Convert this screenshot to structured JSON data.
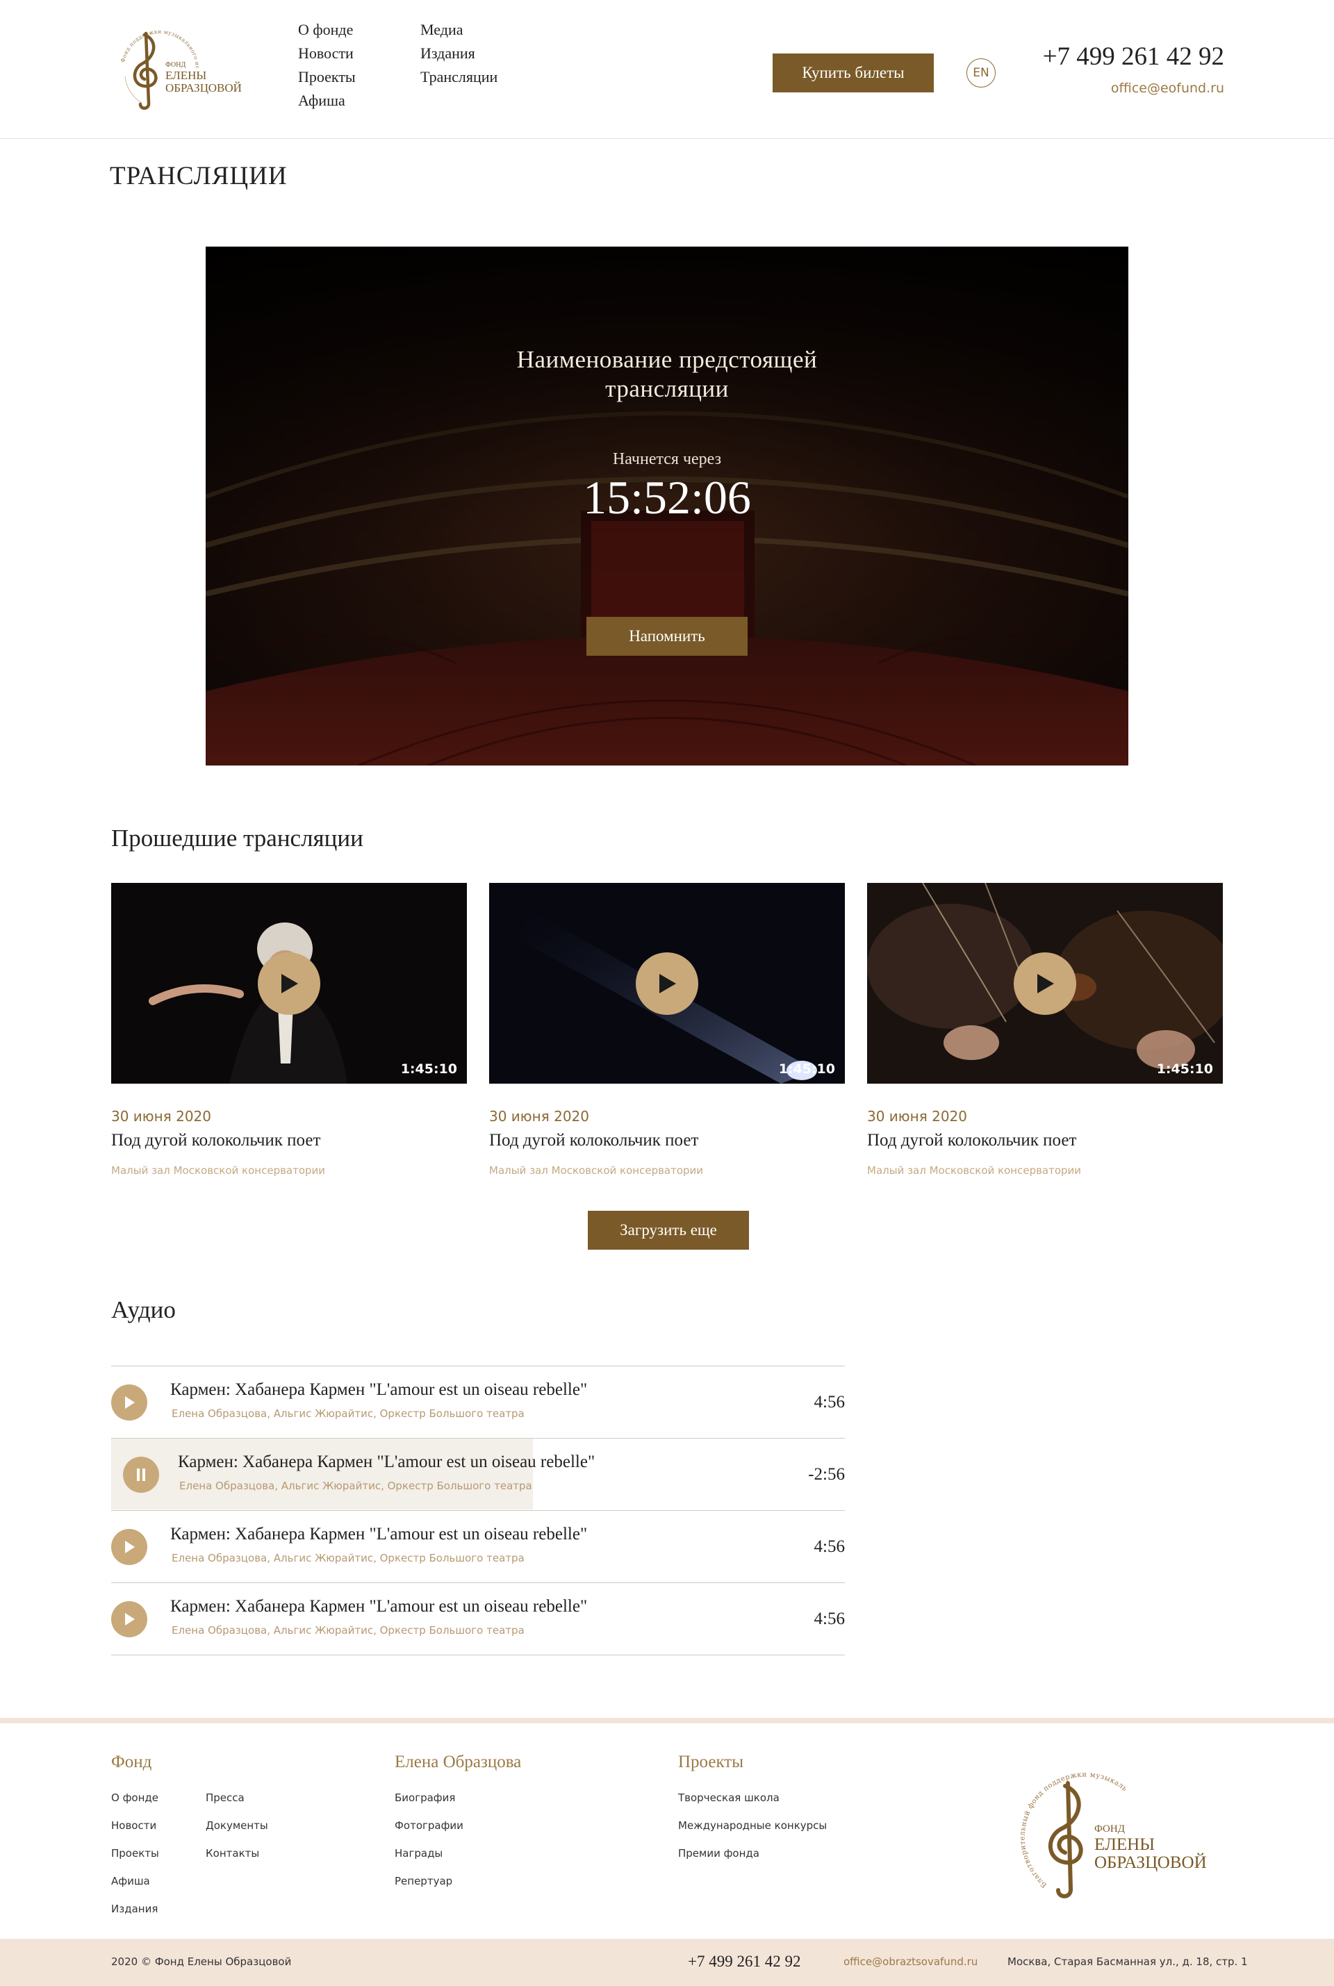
{
  "logo": {
    "arc_text": "Фонд поддержки музыкального искусства",
    "line1": "ФОНД",
    "line2": "ЕЛЕНЫ",
    "line3": "ОБРАЗЦОВОЙ"
  },
  "nav": {
    "col1": [
      "О фонде",
      "Новости",
      "Проекты",
      "Афиша"
    ],
    "col2": [
      "Медиа",
      "Издания",
      "Трансляции"
    ]
  },
  "header": {
    "buy_tickets": "Купить билеты",
    "lang": "EN",
    "phone": "+7 499 261 42 92",
    "email": "office@eofund.ru"
  },
  "page_title": "ТРАНСЛЯЦИИ",
  "hero": {
    "title_line1": "Наименование предстоящей",
    "title_line2": "трансляции",
    "timer_label": "Начнется через",
    "timer": "15:52:06",
    "remind": "Напомнить"
  },
  "past": {
    "heading": "Прошедшие трансляции",
    "cards": [
      {
        "duration": "1:45:10",
        "date": "30 июня 2020",
        "title": "Под дугой колокольчик поет",
        "venue": "Малый зал Московской консерватории"
      },
      {
        "duration": "1:45:10",
        "date": "30 июня 2020",
        "title": "Под дугой колокольчик поет",
        "venue": "Малый зал Московской консерватории"
      },
      {
        "duration": "1:45:10",
        "date": "30 июня 2020",
        "title": "Под дугой колокольчик поет",
        "venue": "Малый зал Московской консерватории"
      }
    ],
    "load_more": "Загрузить еще"
  },
  "audio": {
    "heading": "Аудио",
    "tracks": [
      {
        "title": "Кармен: Хабанера Кармен \"L'amour est un oiseau rebelle\"",
        "performers": "Елена Образцова, Альгис Жюрайтис, Оркестр Большого театра",
        "time": "4:56",
        "state": "paused",
        "progress": 0
      },
      {
        "title": "Кармен: Хабанера Кармен \"L'amour est un oiseau rebelle\"",
        "performers": "Елена Образцова, Альгис Жюрайтис, Оркестр Большого театра",
        "time": "-2:56",
        "state": "playing",
        "progress": 0.575
      },
      {
        "title": "Кармен: Хабанера Кармен \"L'amour est un oiseau rebelle\"",
        "performers": "Елена Образцова, Альгис Жюрайтис, Оркестр Большого театра",
        "time": "4:56",
        "state": "paused",
        "progress": 0
      },
      {
        "title": "Кармен: Хабанера Кармен \"L'amour est un oiseau rebelle\"",
        "performers": "Елена Образцова, Альгис Жюрайтис, Оркестр Большого театра",
        "time": "4:56",
        "state": "paused",
        "progress": 0
      }
    ]
  },
  "footer": {
    "col_fund": {
      "heading": "Фонд",
      "a": [
        "О фонде",
        "Новости",
        "Проекты",
        "Афиша",
        "Издания"
      ],
      "b": [
        "Пресса",
        "Документы",
        "Контакты"
      ]
    },
    "col_elena": {
      "heading": "Елена Образцова",
      "links": [
        "Биография",
        "Фотографии",
        "Награды",
        "Репертуар"
      ]
    },
    "col_projects": {
      "heading": "Проекты",
      "links": [
        "Творческая школа",
        "Международные конкурсы",
        "Премии фонда"
      ]
    },
    "logo_arc_text": "Благотворительный фонд поддержки музыкального искусства"
  },
  "bottom": {
    "copyright": "2020 © Фонд Елены Образцовой",
    "phone": "+7 499 261 42 92",
    "email": "office@obraztsovafund.ru",
    "address": "Москва, Старая Басманная ул., д. 18, стр. 1"
  },
  "colors": {
    "brand_brown": "#7a5a28",
    "gold": "#c9a97a",
    "footer_bg": "#f3e4d8"
  }
}
